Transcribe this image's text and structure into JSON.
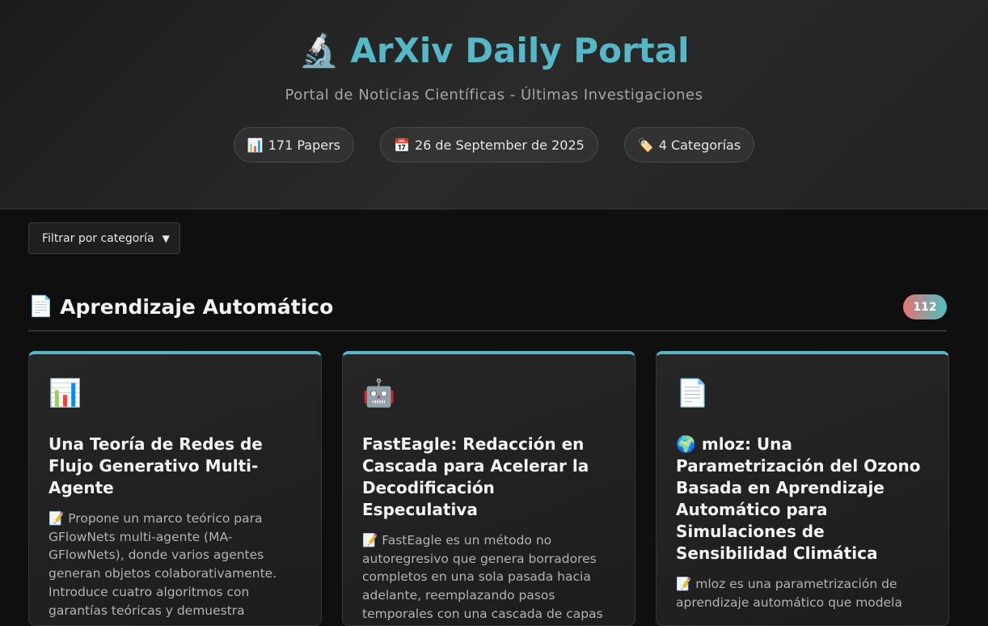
{
  "header": {
    "icon": "microscope-icon",
    "icon_glyph": "🔬",
    "title": "ArXiv Daily Portal",
    "subtitle": "Portal de Noticias Científicas - Últimas Investigaciones",
    "stats": [
      {
        "icon": "📊",
        "label": "171 Papers"
      },
      {
        "icon": "📅",
        "label": "26 de September de 2025"
      },
      {
        "icon": "🏷️",
        "label": "4 Categorías"
      }
    ]
  },
  "filter": {
    "label": "Filtrar por categoría",
    "arrow": "▼"
  },
  "section": {
    "icon": "📄",
    "title": "Aprendizaje Automático",
    "count": "112"
  },
  "cards": [
    {
      "icon": "📊",
      "title": "Una Teoría de Redes de Flujo Generativo Multi-Agente",
      "description": "📝 Propone un marco teórico para GFlowNets multi-agente (MA-GFlowNets), donde varios agentes generan objetos colaborativamente. Introduce cuatro algoritmos con garantías teóricas y demuestra"
    },
    {
      "icon": "🤖",
      "title": "FastEagle: Redacción en Cascada para Acelerar la Decodificación Especulativa",
      "description": "📝 FastEagle es un método no autoregresivo que genera borradores completos en una sola pasada hacia adelante, reemplazando pasos temporales con una cascada de capas livianas. Ofrece aceleraciones"
    },
    {
      "icon": "📄",
      "title": "🌍 mloz: Una Parametrización del Ozono Basada en Aprendizaje Automático para Simulaciones de Sensibilidad Climática",
      "description": "📝 mloz es una parametrización de aprendizaje automático que modela"
    }
  ],
  "colors": {
    "accent": "#56b8c6",
    "badge_gradient_start": "#e57373",
    "badge_gradient_end": "#4ec0c0",
    "background": "#0f0f0f"
  }
}
